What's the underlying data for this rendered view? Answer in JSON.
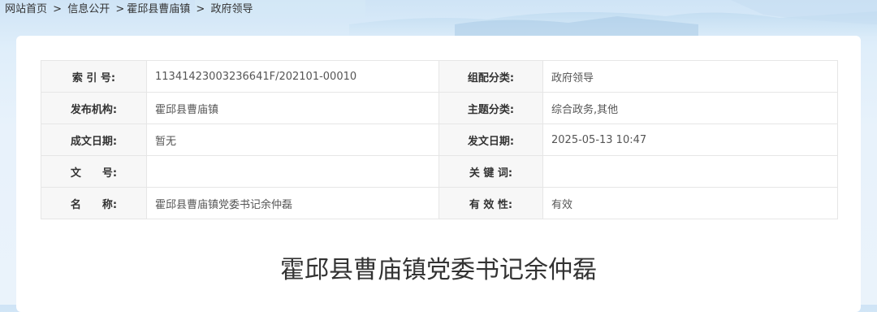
{
  "breadcrumb": {
    "home": "网站首页",
    "info": "信息公开",
    "town": "霍邱县曹庙镇",
    "current": "政府领导",
    "sep1": ">",
    "sep2": ">",
    "sep3": ">"
  },
  "meta": {
    "rows": [
      {
        "label1": "索 引 号:",
        "value1": "11341423003236641F/202101-00010",
        "label2": "组配分类:",
        "value2": "政府领导"
      },
      {
        "label1": "发布机构:",
        "value1": "霍邱县曹庙镇",
        "label2": "主题分类:",
        "value2": "综合政务,其他"
      },
      {
        "label1": "成文日期:",
        "value1": "暂无",
        "label2": "发文日期:",
        "value2": "2025-05-13 10:47"
      },
      {
        "label1": "文　　号:",
        "value1": "",
        "label2": "关 键 词:",
        "value2": ""
      },
      {
        "label1": "名　　称:",
        "value1": "霍邱县曹庙镇党委书记余仲磊",
        "label2": "有 效 性:",
        "value2": "有效"
      }
    ]
  },
  "article": {
    "title": "霍邱县曹庙镇党委书记余仲磊"
  },
  "colors": {
    "sky": "#cfe4f6",
    "panel": "#ffffff",
    "label_bg": "#f7f7f7",
    "border": "#e6e6e6",
    "text": "#333333"
  }
}
